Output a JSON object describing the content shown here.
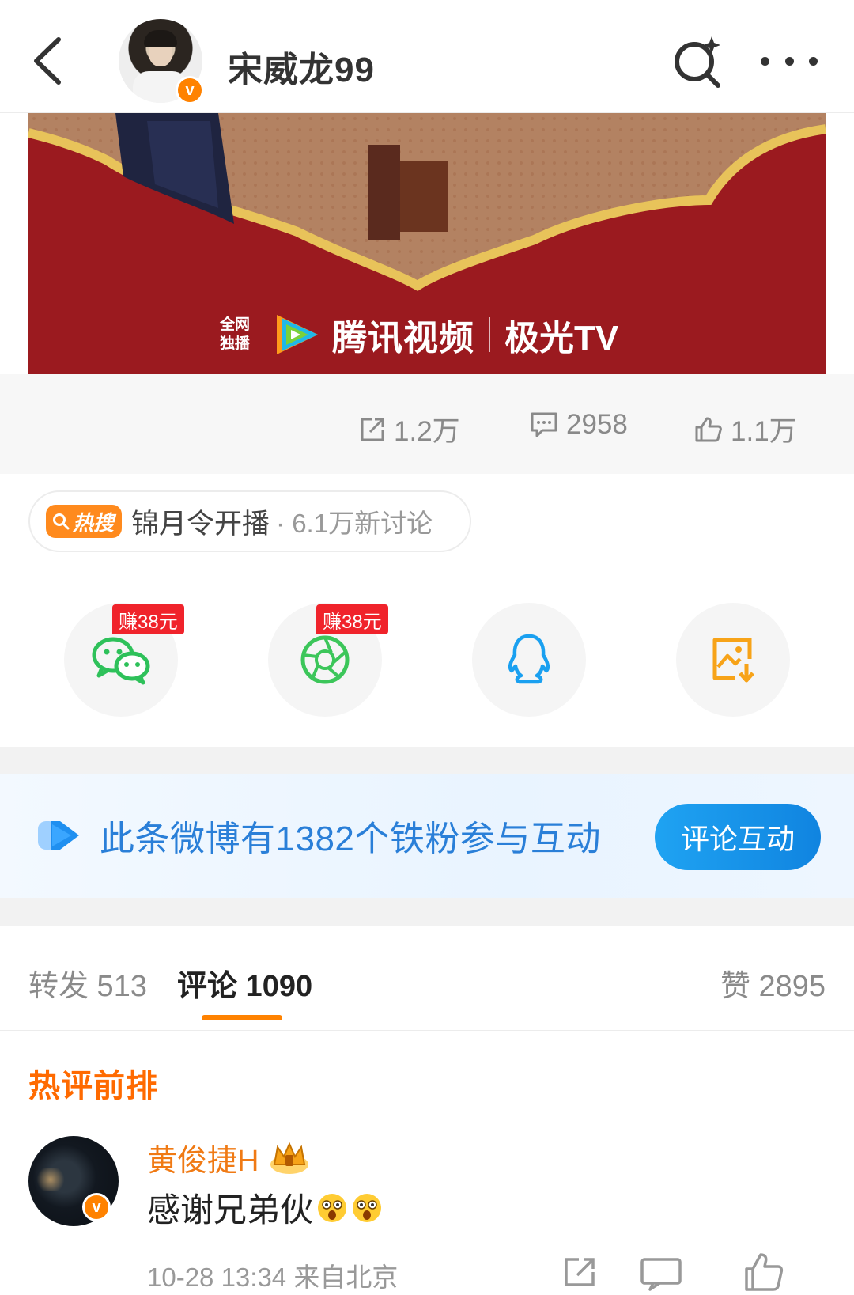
{
  "header": {
    "username": "宋威龙99"
  },
  "banner": {
    "tag": "全网独播",
    "tag_line1": "全网",
    "tag_line2": "独播",
    "brand": "腾讯视频",
    "brand2": "极光TV"
  },
  "stats": {
    "reposts": "1.2万",
    "comments": "2958",
    "likes": "1.1万"
  },
  "hot_search": {
    "badge": "热搜",
    "topic": "锦月令开播",
    "meta": "· 6.1万新讨论"
  },
  "share": {
    "items": [
      {
        "icon": "wechat-icon",
        "earn": "赚38元"
      },
      {
        "icon": "moments-icon",
        "earn": "赚38元"
      },
      {
        "icon": "qq-icon"
      },
      {
        "icon": "save-image-icon"
      }
    ]
  },
  "fan_interaction": {
    "text": "此条微博有1382个铁粉参与互动",
    "button": "评论互动"
  },
  "tabs": {
    "repost": "转发 513",
    "comment": "评论 1090",
    "like": "赞 2895"
  },
  "comments": {
    "section_title": "热评前排",
    "items": [
      {
        "name": "黄俊捷H",
        "text": "感谢兄弟伙",
        "meta": "10-28 13:34  来自北京"
      }
    ]
  },
  "colors": {
    "accent": "#ff8200",
    "banner_red": "#9b1a1f",
    "fan_blue": "#2a7fd8",
    "hot_orange": "#ff6a00"
  }
}
